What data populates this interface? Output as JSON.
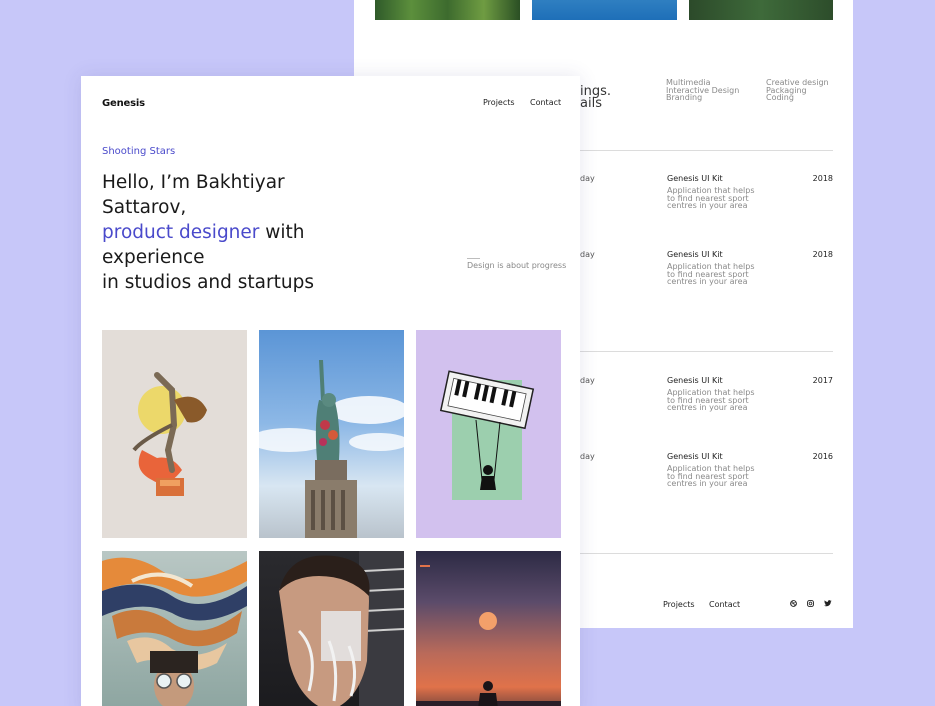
{
  "back": {
    "heading_line1": "ings.",
    "heading_line2": "ails",
    "categories_1": [
      "Multimedia",
      "Interactive Design",
      "Branding"
    ],
    "categories_2": [
      "Creative design",
      "Packaging",
      "Coding"
    ],
    "rows": [
      {
        "day": "day",
        "title": "Genesis UI Kit",
        "desc": "Application that helps to find nearest sport centres in your area",
        "year": "2018"
      },
      {
        "day": "day",
        "title": "Genesis UI Kit",
        "desc": "Application that helps to find nearest sport centres in your area",
        "year": "2018"
      },
      {
        "day": "day",
        "title": "Genesis UI Kit",
        "desc": "Application that helps to find nearest sport centres in your area",
        "year": "2017"
      },
      {
        "day": "day",
        "title": "Genesis UI Kit",
        "desc": "Application that helps to find nearest sport centres in your area",
        "year": "2016"
      }
    ],
    "footer": {
      "projects": "Projects",
      "contact": "Contact"
    },
    "social_icons": [
      "dribbble-icon",
      "instagram-icon",
      "twitter-icon"
    ]
  },
  "front": {
    "logo": "Genesis",
    "nav": {
      "projects": "Projects",
      "contact": "Contact"
    },
    "tagline": "Shooting Stars",
    "headline": {
      "line1": "Hello, I’m Bakhtiyar Sattarov,",
      "accent": "product designer",
      "after_accent": " with experience",
      "line3": "in studios and startups"
    },
    "progress_text": "Design is about progress"
  },
  "colors": {
    "background": "#c7c7f9",
    "accent": "#4a4acb"
  }
}
